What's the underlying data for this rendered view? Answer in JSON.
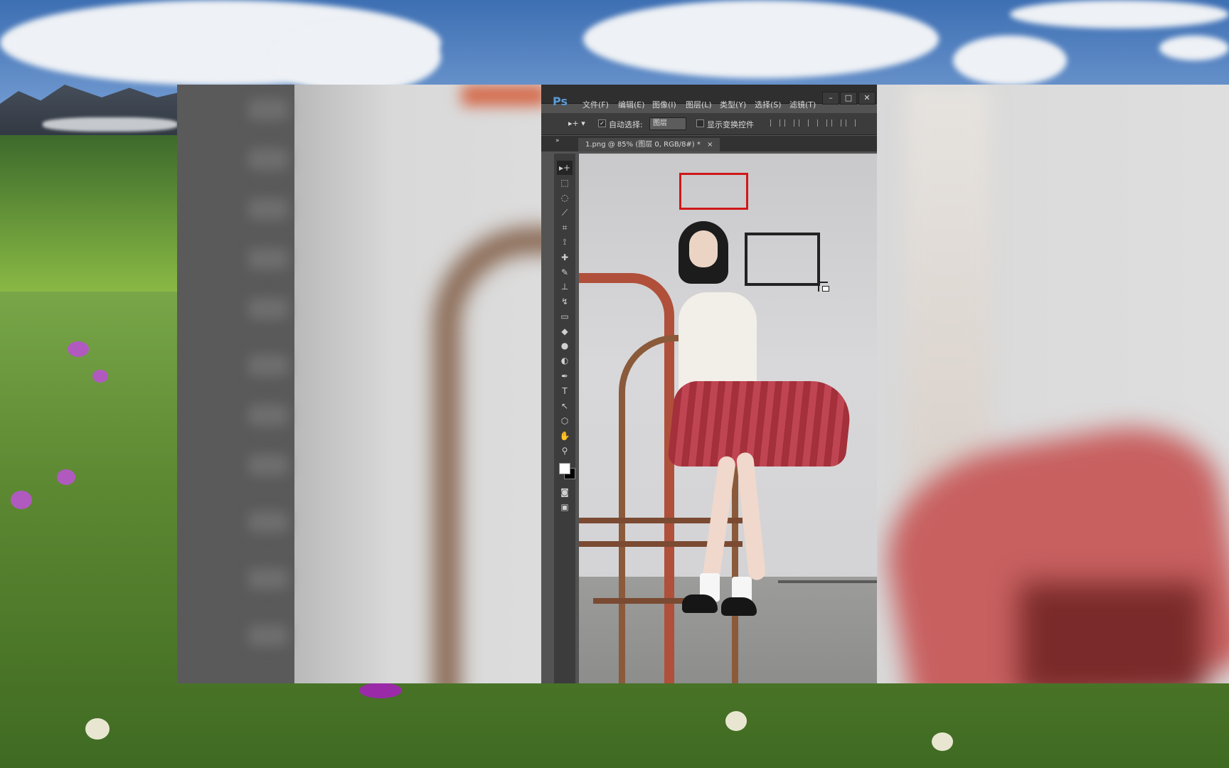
{
  "photoshop": {
    "logo": "Ps",
    "menu": [
      "文件(F)",
      "编辑(E)",
      "图像(I)",
      "图层(L)",
      "类型(Y)",
      "选择(S)",
      "滤镜(T)"
    ],
    "window_buttons": [
      "–",
      "□",
      "✕"
    ],
    "options": {
      "auto_select_label": "自动选择:",
      "auto_select_checked": true,
      "auto_select_value": "图层",
      "show_transform_label": "显示变换控件"
    },
    "tab_collapse": "»",
    "document_tab": {
      "title": "1.png @ 85% (图层 0, RGB/8#) *",
      "close": "×"
    },
    "tools": [
      "move-icon",
      "marquee-icon",
      "lasso-icon",
      "quick-select-icon",
      "crop-icon",
      "eyedropper-icon",
      "healing-icon",
      "brush-icon",
      "stamp-icon",
      "history-brush-icon",
      "eraser-icon",
      "paint-bucket-icon",
      "dodge-icon",
      "sharpen-icon",
      "pen-icon",
      "type-icon",
      "path-select-icon",
      "shape-icon",
      "hand-icon",
      "zoom-icon"
    ],
    "tool_glyphs": [
      "▸+",
      "⬚",
      "◌",
      "⟋",
      "⌗",
      "⟟",
      "✚",
      "✎",
      "⊥",
      "↯",
      "▭",
      "◆",
      "●",
      "◐",
      "✒",
      "T",
      "↖",
      "⬡",
      "✋",
      "⚲"
    ],
    "colors": {
      "foreground": "#ffffff",
      "background": "#000000",
      "selection_rect": "#d01818"
    }
  }
}
